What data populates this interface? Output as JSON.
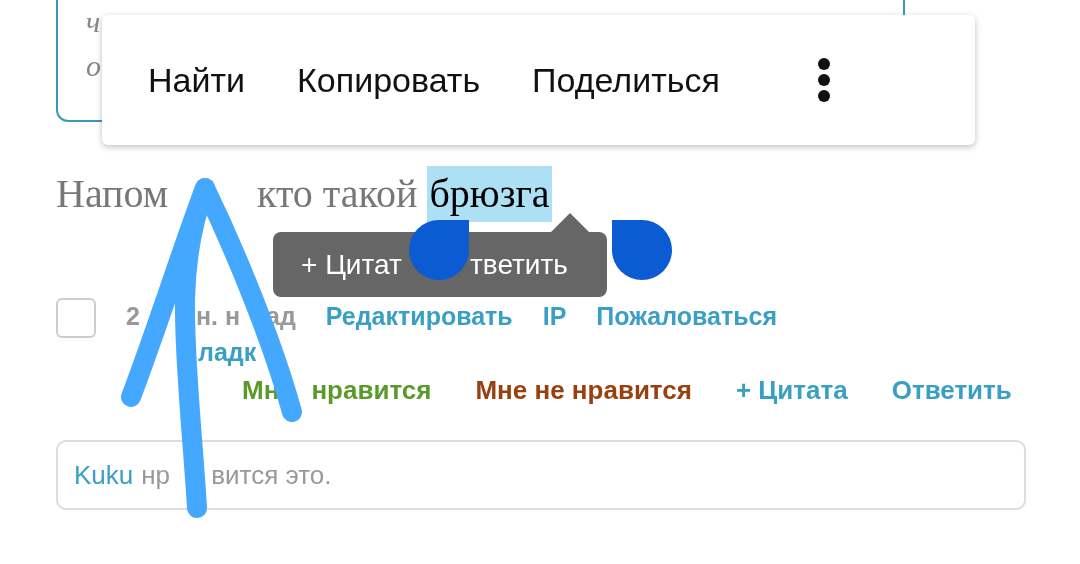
{
  "quote": {
    "lines": [
      "ч",
      "о"
    ]
  },
  "context_menu": {
    "items": [
      "Найти",
      "Копировать",
      "Поделиться"
    ]
  },
  "post": {
    "text_parts": [
      "Напом",
      "кто такой"
    ],
    "selected_text": "брюзга"
  },
  "selection_popup": {
    "actions": [
      "+ Цитат",
      "тветить"
    ]
  },
  "meta": {
    "checked": false,
    "time_parts": [
      "2",
      "н. н",
      "ад"
    ],
    "links": [
      "Редактировать",
      "IP",
      "Пожаловаться",
      "ладк"
    ]
  },
  "reactions": [
    {
      "parts": [
        "Мн",
        "нравится"
      ],
      "color": "#5a9a2a"
    },
    {
      "parts": [
        "Мне не нравится"
      ],
      "color": "#99400f"
    },
    {
      "parts": [
        "+ Цитата"
      ],
      "color": "#3a9fc4"
    },
    {
      "parts": [
        "Ответить"
      ],
      "color": "#3a9fc4"
    }
  ],
  "likes": {
    "user": "Kuku",
    "text_parts": [
      "нр",
      "вится это."
    ]
  }
}
